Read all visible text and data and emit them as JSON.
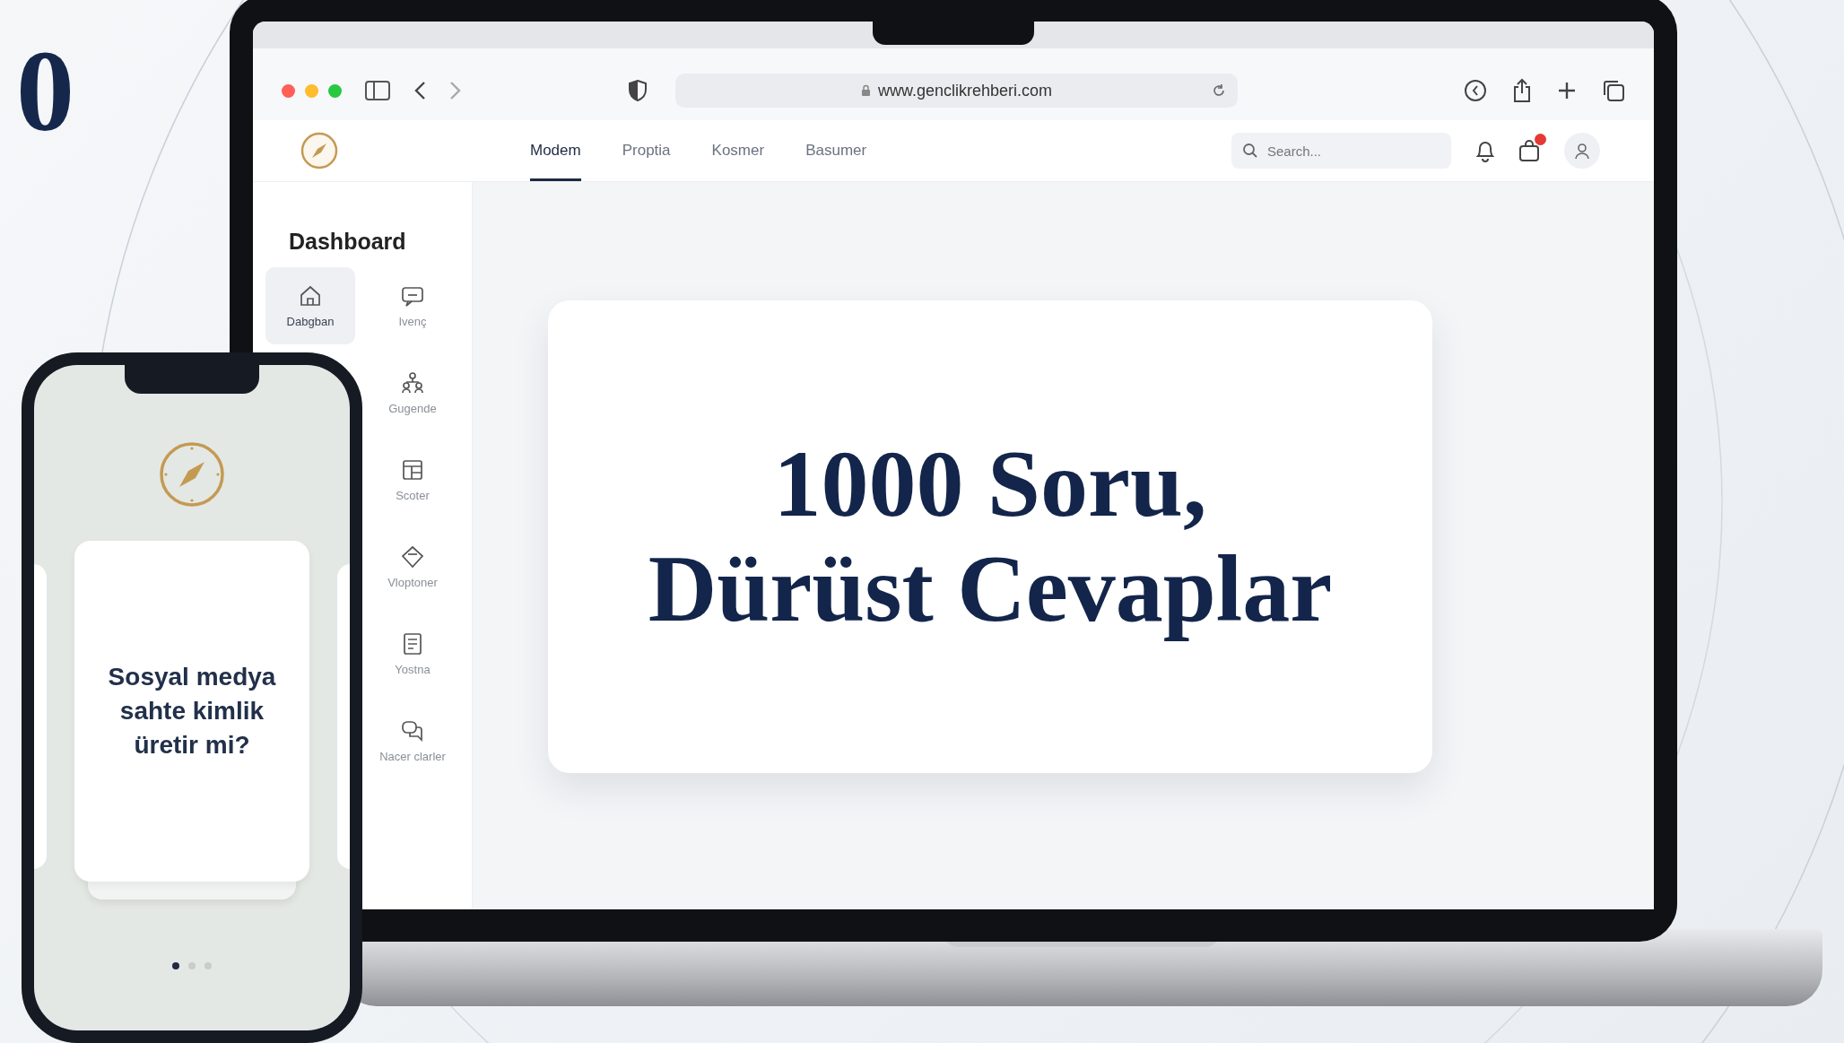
{
  "corner_text": "0",
  "browser": {
    "url": "www.genclikrehberi.com"
  },
  "nav": {
    "tabs": [
      {
        "label": "Modem",
        "selected": true
      },
      {
        "label": "Proptia",
        "selected": false
      },
      {
        "label": "Kosmer",
        "selected": false
      },
      {
        "label": "Basumer",
        "selected": false
      }
    ],
    "search": {
      "placeholder": "Search..."
    },
    "cart_badge": true
  },
  "sidebar": {
    "title": "Dashboard",
    "items": [
      {
        "label": "Dabgban",
        "kind": "home",
        "selected": true
      },
      {
        "label": "Ivenç",
        "kind": "chat",
        "selected": false
      },
      {
        "label": "Gugende",
        "kind": "people",
        "selected": false
      },
      {
        "label": "Scoter",
        "kind": "grid",
        "selected": false
      },
      {
        "label": "Vloptoner",
        "kind": "diamond",
        "selected": false
      },
      {
        "label": "Yostna",
        "kind": "list",
        "selected": false
      },
      {
        "label": "Nacer clarler",
        "kind": "bubbles",
        "selected": false
      }
    ]
  },
  "hero": {
    "lines": [
      "1000 Soru,",
      "Dürüst Cevaplar"
    ]
  },
  "phone": {
    "question": "Sosyal medya sahte kimlik üretir mi?",
    "pages": [
      {
        "selected": true
      },
      {
        "selected": false
      },
      {
        "selected": false
      }
    ]
  }
}
